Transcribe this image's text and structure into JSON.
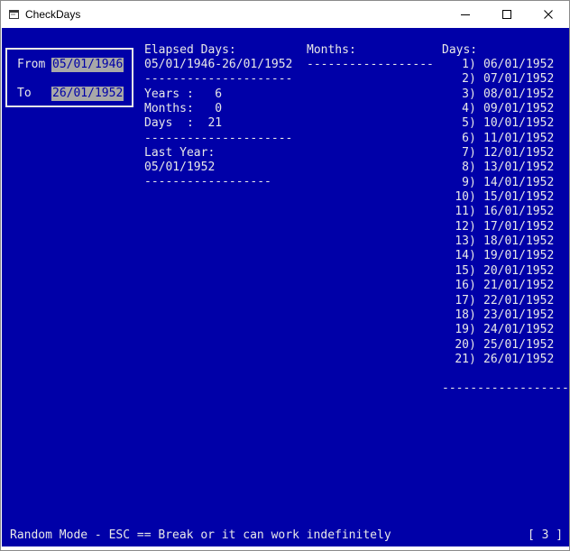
{
  "window": {
    "title": "CheckDays",
    "minimize": "—",
    "maximize": "☐",
    "close": "✕"
  },
  "form": {
    "from_label": "From",
    "from_value": "05/01/1946",
    "to_label": "To",
    "to_value": "26/01/1952"
  },
  "elapsed": {
    "heading": "Elapsed Days:",
    "range": "05/01/1946-26/01/1952",
    "sep1": "---------------------",
    "years": "Years :   6",
    "months": "Months:   0",
    "days": "Days  :  21",
    "sep2": "---------------------",
    "last_year_heading": "Last Year:",
    "last_year_value": "05/01/1952",
    "sep3": "------------------"
  },
  "months_col": {
    "heading": "Months:",
    "sep": "------------------"
  },
  "days_col": {
    "heading": "Days:",
    "items": [
      {
        "n": "1",
        "date": "06/01/1952"
      },
      {
        "n": "2",
        "date": "07/01/1952"
      },
      {
        "n": "3",
        "date": "08/01/1952"
      },
      {
        "n": "4",
        "date": "09/01/1952"
      },
      {
        "n": "5",
        "date": "10/01/1952"
      },
      {
        "n": "6",
        "date": "11/01/1952"
      },
      {
        "n": "7",
        "date": "12/01/1952"
      },
      {
        "n": "8",
        "date": "13/01/1952"
      },
      {
        "n": "9",
        "date": "14/01/1952"
      },
      {
        "n": "10",
        "date": "15/01/1952"
      },
      {
        "n": "11",
        "date": "16/01/1952"
      },
      {
        "n": "12",
        "date": "17/01/1952"
      },
      {
        "n": "13",
        "date": "18/01/1952"
      },
      {
        "n": "14",
        "date": "19/01/1952"
      },
      {
        "n": "15",
        "date": "20/01/1952"
      },
      {
        "n": "16",
        "date": "21/01/1952"
      },
      {
        "n": "17",
        "date": "22/01/1952"
      },
      {
        "n": "18",
        "date": "23/01/1952"
      },
      {
        "n": "19",
        "date": "24/01/1952"
      },
      {
        "n": "20",
        "date": "25/01/1952"
      },
      {
        "n": "21",
        "date": "26/01/1952"
      }
    ],
    "sep": "------------------"
  },
  "status": {
    "message": "Random Mode - ESC == Break or it can work indefinitely",
    "counter": "[ 3 ]"
  },
  "colors": {
    "console_bg": "#0000a8",
    "console_fg": "#e8e8e8",
    "field_bg": "#a8a8a8"
  }
}
